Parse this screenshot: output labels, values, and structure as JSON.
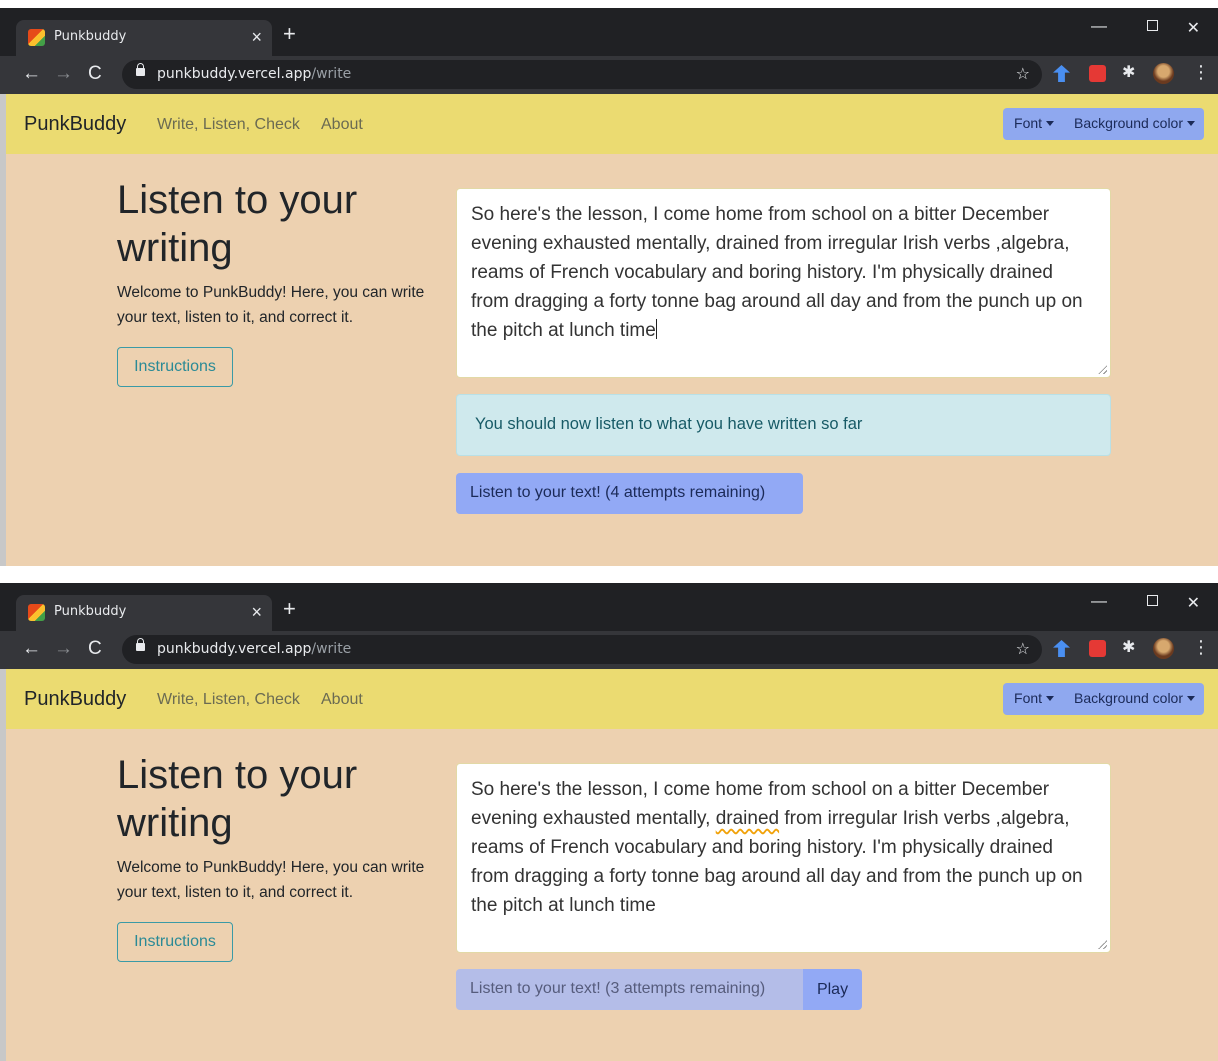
{
  "browser": {
    "tab_title": "Punkbuddy",
    "tab_close": "×",
    "new_tab": "+",
    "url_host": "punkbuddy.vercel.app",
    "url_path": "/write",
    "win_min": "—",
    "win_close": "✕"
  },
  "navbar": {
    "brand": "PunkBuddy",
    "links": [
      "Write, Listen, Check",
      "About"
    ],
    "font_dropdown": "Font",
    "background_dropdown": "Background color"
  },
  "page": {
    "heading": "Listen to your writing",
    "lead": "Welcome to PunkBuddy! Here, you can write your text, listen to it, and correct it.",
    "instructions_button": "Instructions"
  },
  "editor": {
    "text_before_misspelled": "So here's the lesson, I come home from school on a bitter December evening exhausted mentally, ",
    "flagged_word": "drained",
    "text_after_misspelled": " from irregular Irish verbs ,algebra, reams of French vocabulary and boring history. I'm physically drained from dragging a forty tonne bag around all day and from the punch up on the pitch at lunch time"
  },
  "screen1": {
    "alert": "You should now listen to what you have written so far",
    "listen_button": "Listen to your text! (4 attempts remaining)"
  },
  "screen2": {
    "listen_button": "Listen to your text! (3 attempts remaining)",
    "play_button": "Play"
  },
  "colors": {
    "navbar": "#ebdb71",
    "page_bg": "#edd1b0",
    "primary_btn": "#92a9f5",
    "alert_bg": "#cfe9ed"
  }
}
